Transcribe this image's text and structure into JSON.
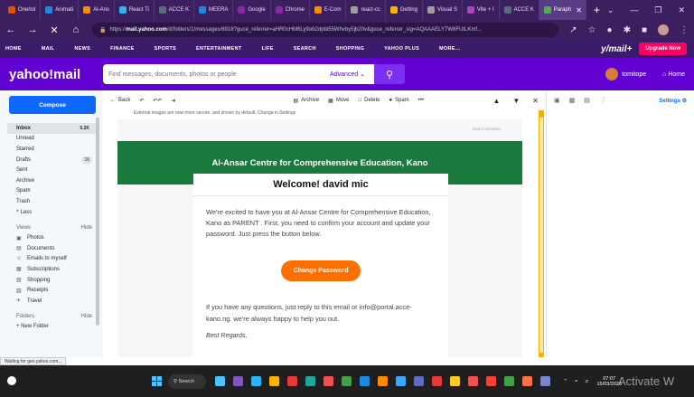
{
  "browser": {
    "tabs": [
      {
        "label": "Onehol",
        "color": "#e65100"
      },
      {
        "label": "Animati",
        "color": "#1e88e5"
      },
      {
        "label": "Al-Ans",
        "color": "#fb8c00"
      },
      {
        "label": "React Ti",
        "color": "#29b6f6"
      },
      {
        "label": "ACCE K",
        "color": "#546e7a"
      },
      {
        "label": "MEERA",
        "color": "#1e88e5"
      },
      {
        "label": "Google",
        "color": "#8e24aa"
      },
      {
        "label": "Chrome",
        "color": "#8e24aa"
      },
      {
        "label": "E-Com",
        "color": "#fb8c00"
      },
      {
        "label": "react-cc",
        "color": "#9e9e9e"
      },
      {
        "label": "Getting",
        "color": "#ffb300"
      },
      {
        "label": "Visual S",
        "color": "#9e9e9e"
      },
      {
        "label": "Vite + I",
        "color": "#ab47bc"
      },
      {
        "label": "ACCE K",
        "color": "#546e7a"
      },
      {
        "label": "Paraph",
        "color": "#4caf50"
      }
    ],
    "url_prefix": "https://",
    "url_domain": "mail.yahoo.com",
    "url_rest": "/d/folders/1/messages/6918?guce_referrer=aHR0cHM6Ly9ob2dpbi55Whvby5jb20v&guce_referrer_sig=AQAAAELY7W6FUtLKmf..."
  },
  "yahoo_nav": {
    "items": [
      "HOME",
      "MAIL",
      "NEWS",
      "FINANCE",
      "SPORTS",
      "ENTERTAINMENT",
      "LIFE",
      "SEARCH",
      "SHOPPING",
      "YAHOO PLUS",
      "MORE..."
    ],
    "logo": "y/mail+",
    "upgrade": "Upgrade Now"
  },
  "header": {
    "logo": "yahoo!mail",
    "search_placeholder": "Find messages, documents, photos or people",
    "advanced": "Advanced",
    "username": "tomitope",
    "home": "Home"
  },
  "sidebar": {
    "compose": "Compose",
    "folders": [
      {
        "label": "Inbox",
        "count": "5.2K",
        "active": true
      },
      {
        "label": "Unread",
        "count": ""
      },
      {
        "label": "Starred",
        "count": ""
      },
      {
        "label": "Drafts",
        "count": "16"
      },
      {
        "label": "Sent",
        "count": ""
      },
      {
        "label": "Archive",
        "count": ""
      },
      {
        "label": "Spam",
        "count": ""
      },
      {
        "label": "Trash",
        "count": ""
      },
      {
        "label": "^ Less",
        "count": ""
      }
    ],
    "views_label": "Views",
    "views_hide": "Hide",
    "views": [
      "Photos",
      "Documents",
      "Emails to myself",
      "Subscriptions",
      "Shopping",
      "Receipts",
      "Travel"
    ],
    "folders_label": "Folders",
    "folders_hide": "Hide",
    "new_folder": "+ New Folder"
  },
  "toolbar": {
    "back": "Back",
    "archive": "Archive",
    "move": "Move",
    "delete": "Delete",
    "spam": "Spam",
    "more": "•••"
  },
  "email": {
    "notice": "External images are now more secure, and shown by default. Change in Settings",
    "view_in_browser": "View in browser",
    "org_name": "Al-Ansar Centre for Comprehensive Education, Kano",
    "welcome": "Welcome! david mic",
    "para1": "We're excited to have you at Al-Ansar Centre for Comprehensive Education, Kano as PARENT . First, you need to confirm your account and update your password. Just press the button below.",
    "cta": "Change Password",
    "para2": "If you have any questions, just reply to this email or info@portal.acce-kano.ng. we're always happy to help you out.",
    "regards": "Best Regards,"
  },
  "rail": {
    "settings": "Settings"
  },
  "status_bar": "Waiting for geo.yahoo.com...",
  "taskbar": {
    "search": "Search",
    "time": "07:07",
    "date": "15/03/2023",
    "watermark": "Activate W"
  },
  "colors": {
    "yahoo_purple": "#6001d2",
    "compose_blue": "#0f69ff",
    "green_banner": "#1a7a3e",
    "cta_orange": "#ff6f00"
  }
}
